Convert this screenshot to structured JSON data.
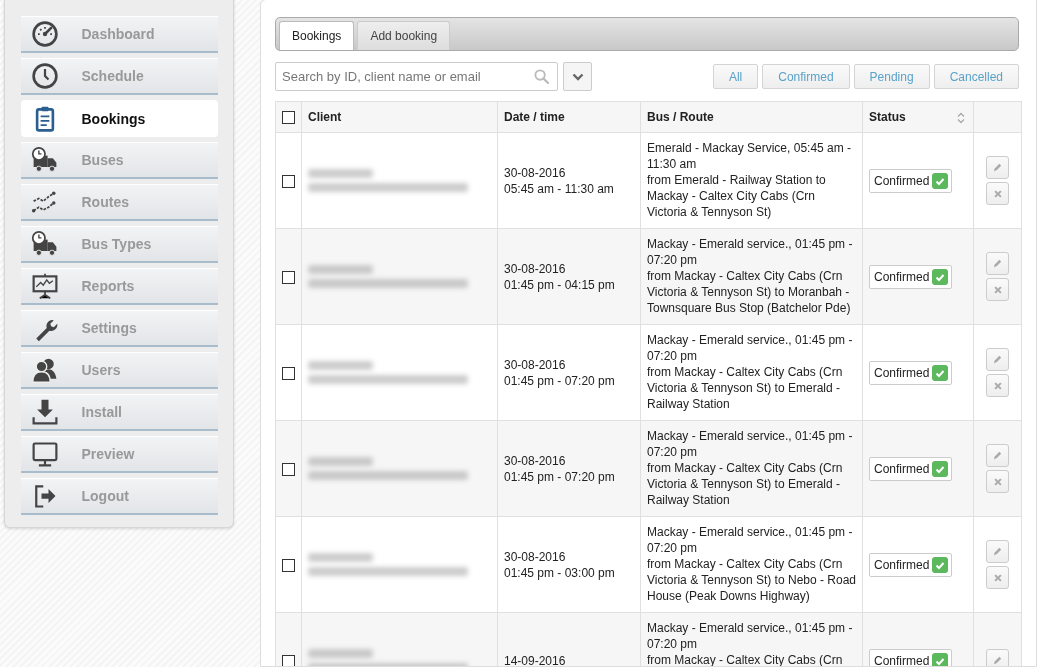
{
  "sidebar": {
    "items": [
      {
        "label": "Dashboard",
        "selected": false
      },
      {
        "label": "Schedule",
        "selected": false
      },
      {
        "label": "Bookings",
        "selected": true
      },
      {
        "label": "Buses",
        "selected": false
      },
      {
        "label": "Routes",
        "selected": false
      },
      {
        "label": "Bus Types",
        "selected": false
      },
      {
        "label": "Reports",
        "selected": false
      },
      {
        "label": "Settings",
        "selected": false
      },
      {
        "label": "Users",
        "selected": false
      },
      {
        "label": "Install",
        "selected": false
      },
      {
        "label": "Preview",
        "selected": false
      },
      {
        "label": "Logout",
        "selected": false
      }
    ]
  },
  "tabs": [
    {
      "label": "Bookings",
      "selected": true
    },
    {
      "label": "Add booking",
      "selected": false
    }
  ],
  "search": {
    "placeholder": "Search by ID, client name or email"
  },
  "filters": [
    {
      "label": "All"
    },
    {
      "label": "Confirmed"
    },
    {
      "label": "Pending"
    },
    {
      "label": "Cancelled"
    }
  ],
  "table": {
    "select_all": false,
    "columns": [
      "Client",
      "Date / time",
      "Bus / Route",
      "Status"
    ],
    "rows": [
      {
        "selected": false,
        "client_redacted": true,
        "date": "30-08-2016",
        "time": "05:45 am - 11:30 am",
        "route_title": "Emerald - Mackay Service, 05:45 am - 11:30 am",
        "route_detail": "from Emerald - Railway Station to Mackay - Caltex City Cabs (Crn Victoria & Tennyson St)",
        "status": "Confirmed",
        "confirmed": true
      },
      {
        "selected": false,
        "client_redacted": true,
        "date": "30-08-2016",
        "time": "01:45 pm - 04:15 pm",
        "route_title": "Mackay - Emerald service., 01:45 pm - 07:20 pm",
        "route_detail": "from Mackay - Caltex City Cabs (Crn Victoria & Tennyson St) to Moranbah - Townsquare Bus Stop (Batchelor Pde)",
        "status": "Confirmed",
        "confirmed": true
      },
      {
        "selected": false,
        "client_redacted": true,
        "date": "30-08-2016",
        "time": "01:45 pm - 07:20 pm",
        "route_title": "Mackay - Emerald service., 01:45 pm - 07:20 pm",
        "route_detail": "from Mackay - Caltex City Cabs (Crn Victoria & Tennyson St) to Emerald - Railway Station",
        "status": "Confirmed",
        "confirmed": true
      },
      {
        "selected": false,
        "client_redacted": true,
        "date": "30-08-2016",
        "time": "01:45 pm - 07:20 pm",
        "route_title": "Mackay - Emerald service., 01:45 pm - 07:20 pm",
        "route_detail": "from Mackay - Caltex City Cabs (Crn Victoria & Tennyson St) to Emerald - Railway Station",
        "status": "Confirmed",
        "confirmed": true
      },
      {
        "selected": false,
        "client_redacted": true,
        "date": "30-08-2016",
        "time": "01:45 pm - 03:00 pm",
        "route_title": "Mackay - Emerald service., 01:45 pm - 07:20 pm",
        "route_detail": "from Mackay - Caltex City Cabs (Crn Victoria & Tennyson St) to Nebo - Road House (Peak Downs Highway)",
        "status": "Confirmed",
        "confirmed": true
      },
      {
        "selected": false,
        "client_redacted": true,
        "date": "14-09-2016",
        "route_title": "Mackay - Emerald service., 01:45 pm - 07:20 pm",
        "route_detail": "from Mackay - Caltex City Cabs (Crn",
        "status": "Confirmed",
        "confirmed": true,
        "edit_only": true
      }
    ]
  }
}
